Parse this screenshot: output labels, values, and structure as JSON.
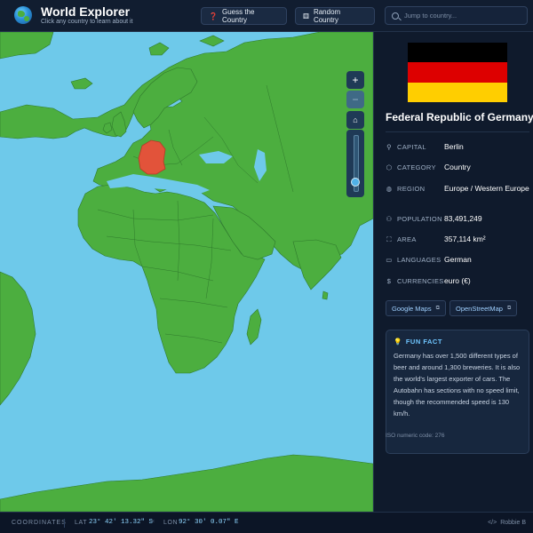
{
  "app": {
    "title": "World Explorer",
    "subtitle": "Click any country to learn about it",
    "logo_icon": "globe-icon"
  },
  "header": {
    "guess_label": "Guess the Country",
    "guess_icon": "question-icon",
    "random_label": "Random Country",
    "random_icon": "dice-icon",
    "search_placeholder": "Jump to country..."
  },
  "map": {
    "selected_country": "Germany",
    "colors": {
      "ocean": "#6ec9ea",
      "land": "#4cae3f",
      "border": "#2f7a2c",
      "selected": "#e2533a"
    },
    "controls": {
      "zoom_in": "+",
      "zoom_out": "−",
      "home_icon": "home-icon"
    },
    "zoom_level_fraction": 0.08
  },
  "country": {
    "flag_colors": [
      "#000000",
      "#dd0000",
      "#ffce00"
    ],
    "name": "Federal Republic of Germany",
    "fields": [
      {
        "label": "CAPITAL",
        "icon": "pin-icon",
        "value": "Berlin"
      },
      {
        "label": "CATEGORY",
        "icon": "tag-icon",
        "value": "Country"
      },
      {
        "label": "REGION",
        "icon": "globe-icon",
        "value": "Europe / Western Europe"
      },
      {
        "label": "POPULATION",
        "icon": "people-icon",
        "value": "83,491,249"
      },
      {
        "label": "AREA",
        "icon": "area-icon",
        "value": "357,114 km²"
      },
      {
        "label": "LANGUAGES",
        "icon": "book-icon",
        "value": "German"
      },
      {
        "label": "CURRENCIES",
        "icon": "dollar-icon",
        "value": "euro (€)"
      }
    ],
    "links": [
      {
        "label": "Google Maps"
      },
      {
        "label": "OpenStreetMap"
      }
    ],
    "fun_fact": {
      "title": "FUN FACT",
      "text": "Germany has over 1,500 different types of beer and around 1,300 breweries. It is also the world's largest exporter of cars. The Autobahn has sections with no speed limit, though the recommended speed is 130 km/h."
    },
    "iso_text": "ISO numeric code: 276"
  },
  "footer": {
    "coords_label": "COORDINATES",
    "lat_label": "LAT",
    "lat_value": "23° 42' 13.32\" S",
    "lon_label": "LON",
    "lon_value": "92° 30' 0.07\" E",
    "credit": "Robbie B"
  }
}
